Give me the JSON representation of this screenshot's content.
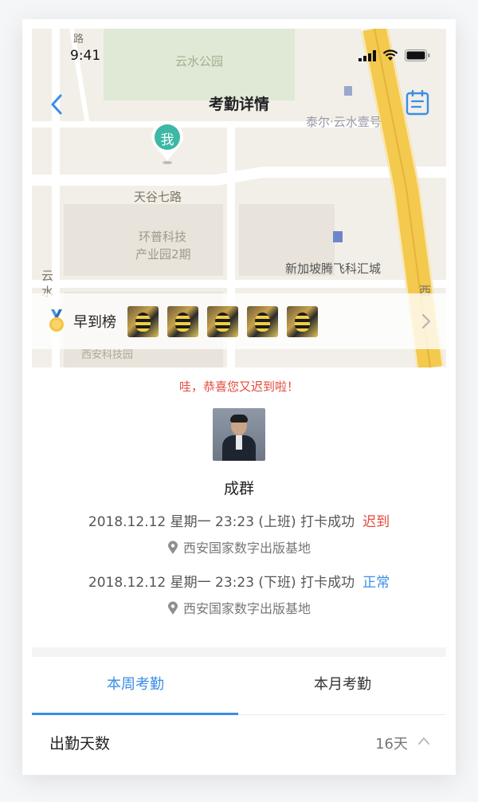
{
  "status_bar": {
    "time": "9:41"
  },
  "nav": {
    "title": "考勤详情"
  },
  "map": {
    "me_marker": "我",
    "labels": {
      "road_top": "路",
      "park": "云水公园",
      "building_top": "泰尔·云水壹号",
      "road_tiangu": "天谷七路",
      "park_line1": "环普科技",
      "park_line2": "产业园2期",
      "singapore": "新加坡腾飞科汇城",
      "yunshui_vertical": "云\n水",
      "xi": "西",
      "bottom_left": "西安科技园"
    }
  },
  "ranking": {
    "title": "早到榜",
    "avatar_count_label": "5",
    "medal_icon": "medal-icon",
    "chevron_icon": "chevron-right-icon"
  },
  "attendance": {
    "congrats": "哇，恭喜您又迟到啦！",
    "user_name": "成群",
    "records": [
      {
        "text": "2018.12.12 星期一 23:23 (上班) 打卡成功",
        "status": "迟到",
        "location": "西安国家数字出版基地"
      },
      {
        "text": "2018.12.12 星期一 23:23 (下班) 打卡成功",
        "status": "正常",
        "location": "西安国家数字出版基地"
      }
    ]
  },
  "tabs": [
    {
      "label": "本周考勤",
      "active": true
    },
    {
      "label": "本月考勤",
      "active": false
    }
  ],
  "summary": {
    "label": "出勤天数",
    "value": "16天"
  },
  "colors": {
    "accent": "#3a8ee6",
    "late": "#e5483b",
    "marker": "#3cb8a6"
  }
}
